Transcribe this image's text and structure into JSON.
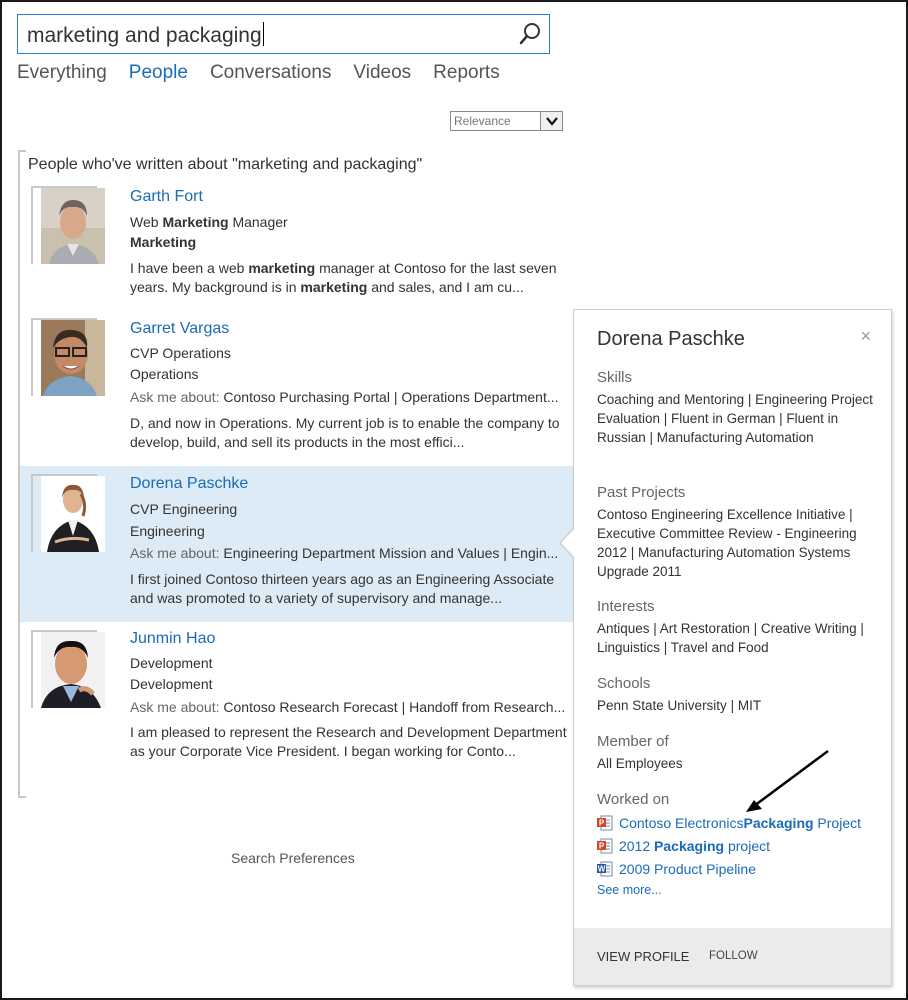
{
  "search": {
    "query": "marketing and packaging",
    "icon": "magnifier-icon"
  },
  "tabs": [
    {
      "label": "Everything",
      "active": false
    },
    {
      "label": "People",
      "active": true
    },
    {
      "label": "Conversations",
      "active": false
    },
    {
      "label": "Videos",
      "active": false
    },
    {
      "label": "Reports",
      "active": false
    }
  ],
  "sort": {
    "selected": "Relevance"
  },
  "results": {
    "heading": "People who've written about \"marketing and packaging\"",
    "people": [
      {
        "name": "Garth Fort",
        "title_pre": "Web ",
        "title_bold": "Marketing",
        "title_post": " Manager",
        "department": "Marketing",
        "desc_1": "I have been a web ",
        "desc_1b": "marketing",
        "desc_2": " manager at Contoso for the last seven years. My background is in ",
        "desc_2b": "marketing",
        "desc_3": " and sales, and I am cu..."
      },
      {
        "name": "Garret Vargas",
        "title": "CVP Operations",
        "department": "Operations",
        "ask_label": "Ask me about: ",
        "ask_value": "Contoso Purchasing Portal | Operations Department...",
        "desc": "D, and now in Operations. My current job is to enable the company to develop, build, and sell its products in the most effici..."
      },
      {
        "name": "Dorena Paschke",
        "title": "CVP Engineering",
        "department": "Engineering",
        "ask_label": "Ask me about: ",
        "ask_value": "Engineering Department Mission and Values | Engin...",
        "desc": "I first joined Contoso thirteen years ago as an Engineering Associate and was promoted to a variety of supervisory and manage...",
        "selected": true
      },
      {
        "name": "Junmin Hao",
        "title": "Development",
        "department": "Development",
        "ask_label": "Ask me about: ",
        "ask_value": "Contoso Research Forecast | Handoff from Research...",
        "desc": "I am pleased to represent the Research and Development Department as your Corporate Vice President. I began working for Conto..."
      }
    ]
  },
  "search_preferences": "Search Preferences",
  "card": {
    "name": "Dorena Paschke",
    "close": "×",
    "skills_label": "Skills",
    "skills": "Coaching and Mentoring | Engineering Project Evaluation | Fluent in German | Fluent in Russian | Manufacturing Automation",
    "past_projects_label": "Past Projects",
    "past_projects": "Contoso Engineering Excellence Initiative | Executive Committee Review - Engineering 2012 | Manufacturing Automation Systems Upgrade 2011",
    "interests_label": "Interests",
    "interests": "Antiques | Art Restoration | Creative Writing | Linguistics | Travel and Food",
    "schools_label": "Schools",
    "schools": "Penn State University | MIT",
    "member_of_label": "Member of",
    "member_of": "All Employees",
    "worked_on_label": "Worked on",
    "worked_on": [
      {
        "type": "powerpoint",
        "pre": "Contoso Electronics ",
        "bold": "Packaging",
        "post": " Project"
      },
      {
        "type": "powerpoint",
        "pre": "2012 ",
        "bold": "Packaging",
        "post": " project"
      },
      {
        "type": "word",
        "pre": "2009 Product Pipeline",
        "bold": "",
        "post": ""
      }
    ],
    "see_more": "See more...",
    "view_profile": "VIEW PROFILE",
    "follow": "FOLLOW"
  },
  "colors": {
    "accent": "#1a6bb8",
    "selected_bg": "#ddebf7",
    "footer_bg": "#ebebeb"
  }
}
